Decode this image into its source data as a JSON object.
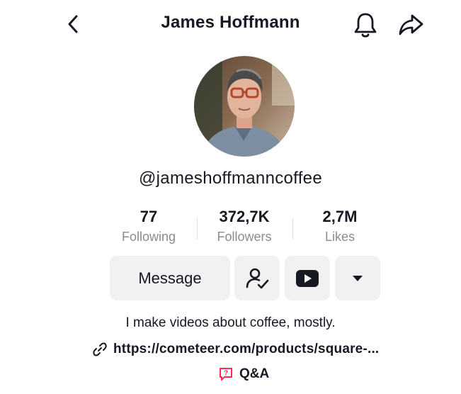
{
  "header": {
    "title": "James Hoffmann"
  },
  "profile": {
    "username": "@jameshoffmanncoffee",
    "bio": "I make videos about coffee, mostly.",
    "link": "https://cometeer.com/products/square-...",
    "qa_label": "Q&A"
  },
  "stats": {
    "following": {
      "value": "77",
      "label": "Following"
    },
    "followers": {
      "value": "372,7K",
      "label": "Followers"
    },
    "likes": {
      "value": "2,7M",
      "label": "Likes"
    }
  },
  "actions": {
    "message_label": "Message"
  },
  "icons": {
    "back": "chevron-left-icon",
    "bell": "bell-icon",
    "share": "share-arrow-icon",
    "follow": "user-check-icon",
    "youtube": "youtube-icon",
    "more": "caret-down-icon",
    "link": "link-icon",
    "qa": "qa-icon"
  },
  "colors": {
    "text": "#161823",
    "secondary_text": "#8a8b91",
    "button_bg": "#f1f1f2",
    "qa_accent": "#fe2c55"
  }
}
